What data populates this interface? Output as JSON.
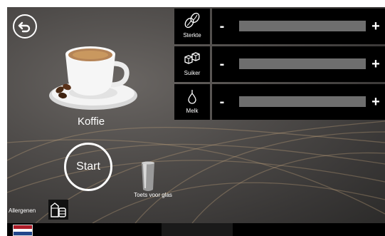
{
  "drink": {
    "name": "Koffie"
  },
  "actions": {
    "start_label": "Start",
    "glass_key_label": "Toets voor glas",
    "allergens_label": "Allergenen"
  },
  "params": [
    {
      "label": "Sterkte",
      "icon": "coffee-beans-icon",
      "minus": "-",
      "plus": "+"
    },
    {
      "label": "Suiker",
      "icon": "sugar-cubes-icon",
      "minus": "-",
      "plus": "+"
    },
    {
      "label": "Melk",
      "icon": "milk-drop-icon",
      "minus": "-",
      "plus": "+"
    }
  ],
  "language": {
    "flag_colors": [
      "#ae1c28",
      "#ffffff",
      "#21468b"
    ]
  },
  "colors": {
    "panel": "#000000",
    "track": "#6e6e6e",
    "background": "#4f4c4a"
  }
}
